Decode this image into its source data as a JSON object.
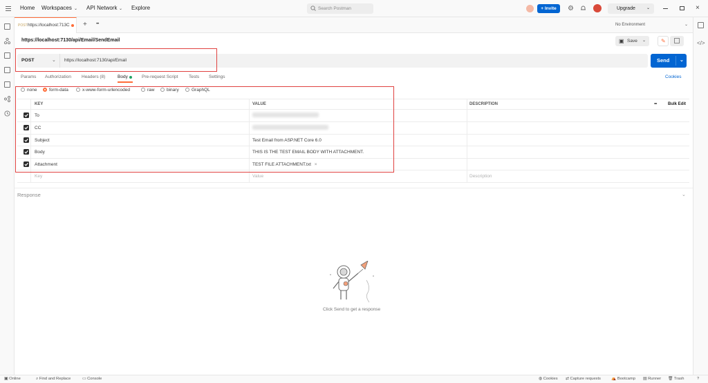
{
  "topbar": {
    "nav": [
      "Home",
      "Workspaces",
      "API Network",
      "Explore"
    ],
    "search_placeholder": "Search Postman",
    "invite_label": "Invite",
    "upgrade_label": "Upgrade"
  },
  "tabs": {
    "active_method": "POST",
    "active_title": "https://localhost:713C",
    "add_symbol": "+",
    "more_symbol": "•••",
    "environment": "No Environment"
  },
  "request": {
    "breadcrumb": "https://localhost:7130/api/Email/SendEmail",
    "save_label": "Save",
    "method": "POST",
    "url": "https://localhost:7130/api/Email",
    "send_label": "Send",
    "cookies_link": "Cookies",
    "tabs": [
      "Params",
      "Authorization",
      "Headers (8)",
      "Body",
      "Pre-request Script",
      "Tests",
      "Settings"
    ],
    "body_types": [
      "none",
      "form-data",
      "x-www-form-urlencoded",
      "raw",
      "binary",
      "GraphQL"
    ]
  },
  "table": {
    "headers": {
      "key": "KEY",
      "value": "VALUE",
      "description": "DESCRIPTION",
      "more": "•••",
      "bulk_edit": "Bulk Edit"
    },
    "rows": [
      {
        "key": "To",
        "value": ""
      },
      {
        "key": "CC",
        "value": ""
      },
      {
        "key": "Subject",
        "value": "Test Email from ASP.NET Core 6.0"
      },
      {
        "key": "Body",
        "value": "THIS IS THE TEST EMAIL BODY WITH ATTACHMENT."
      },
      {
        "key": "Attachment",
        "value": "TEST FILE ATTACHMENT.txt",
        "remove": "×"
      }
    ],
    "placeholders": {
      "key": "Key",
      "value": "Value",
      "description": "Description"
    }
  },
  "response": {
    "title": "Response",
    "empty_message": "Click Send to get a response"
  },
  "statusbar": {
    "left": [
      "Online",
      "Find and Replace",
      "Console"
    ],
    "right": [
      "Cookies",
      "Capture requests",
      "Bootcamp",
      "Runner",
      "Trash"
    ]
  },
  "colors": {
    "accent": "#0265d2",
    "brand": "#ff6c37",
    "highlight": "#e0413f",
    "active_dot": "#21a366"
  }
}
